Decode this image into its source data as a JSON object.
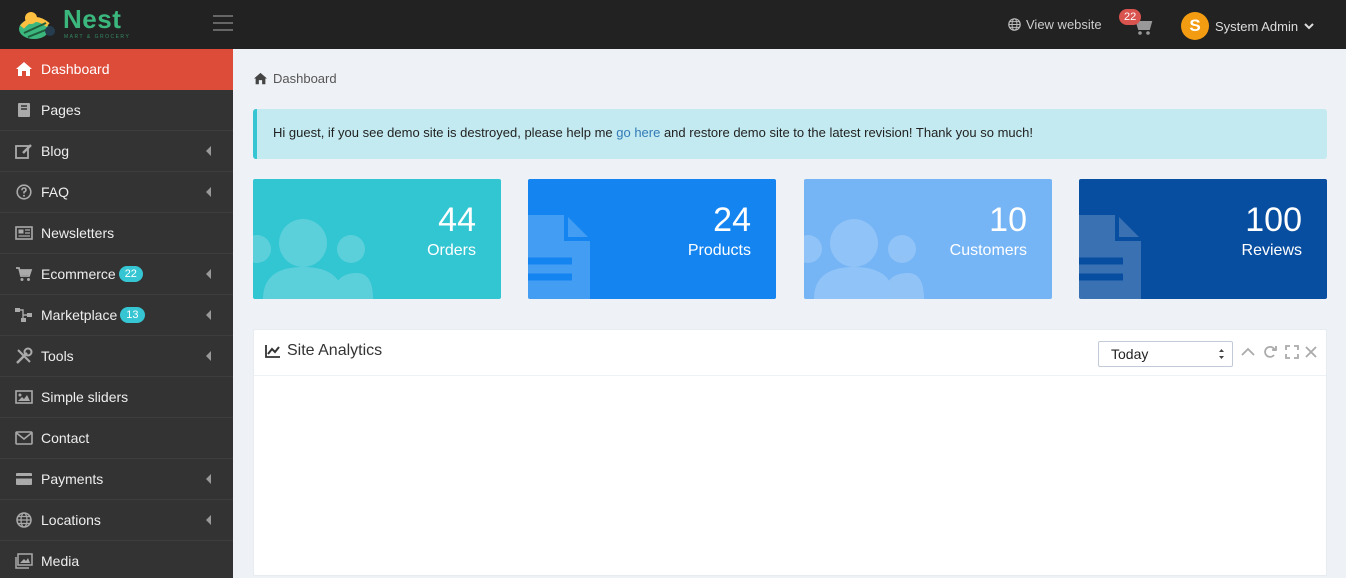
{
  "brand": {
    "name": "Nest",
    "tagline": "MART & GROCERY"
  },
  "header": {
    "view_website": "View website",
    "cart_count": "22",
    "user_initial": "S",
    "user_name": "System Admin"
  },
  "sidebar": {
    "items": [
      {
        "label": "Dashboard",
        "icon": "home-icon",
        "active": true
      },
      {
        "label": "Pages",
        "icon": "book-icon"
      },
      {
        "label": "Blog",
        "icon": "edit-icon",
        "arrow": true
      },
      {
        "label": "FAQ",
        "icon": "question-circle-icon",
        "arrow": true
      },
      {
        "label": "Newsletters",
        "icon": "newspaper-icon"
      },
      {
        "label": "Ecommerce",
        "icon": "cart-icon",
        "badge": "22",
        "arrow": true
      },
      {
        "label": "Marketplace",
        "icon": "sitemap-icon",
        "badge": "13",
        "arrow": true
      },
      {
        "label": "Tools",
        "icon": "tools-icon",
        "arrow": true
      },
      {
        "label": "Simple sliders",
        "icon": "image-icon"
      },
      {
        "label": "Contact",
        "icon": "envelope-icon"
      },
      {
        "label": "Payments",
        "icon": "credit-card-icon",
        "arrow": true
      },
      {
        "label": "Locations",
        "icon": "globe-icon",
        "arrow": true
      },
      {
        "label": "Media",
        "icon": "images-icon"
      }
    ]
  },
  "breadcrumb": {
    "label": "Dashboard"
  },
  "alert": {
    "before": "Hi guest, if you see demo site is destroyed, please help me ",
    "link": "go here",
    "after": " and restore demo site to the latest revision! Thank you so much!"
  },
  "stats": [
    {
      "value": "44",
      "label": "Orders",
      "color": "#32c5d2",
      "icon": "users-icon"
    },
    {
      "value": "24",
      "label": "Products",
      "color": "#1485f0",
      "icon": "file-icon"
    },
    {
      "value": "10",
      "label": "Customers",
      "color": "#75b4f5",
      "icon": "users-icon"
    },
    {
      "value": "100",
      "label": "Reviews",
      "color": "#084ea0",
      "icon": "file-icon"
    }
  ],
  "analytics": {
    "title": "Site Analytics",
    "range_value": "Today"
  }
}
